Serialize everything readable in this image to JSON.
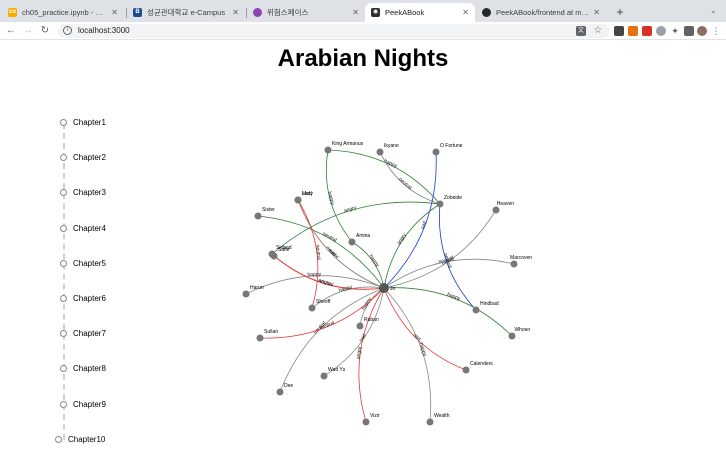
{
  "tabs": [
    {
      "label": "ch05_practice.ipynb - Colabor",
      "icon": "colab-icon",
      "color": "#f9ab00",
      "active": false
    },
    {
      "label": "성균관대학교 e-Campus",
      "icon": "ecampus-icon",
      "color": "#1a4d8f",
      "active": false
    },
    {
      "label": "위험스페이스",
      "icon": "space-icon",
      "color": "#8e44ad",
      "active": false
    },
    {
      "label": "PeekABook",
      "icon": "peekabook-icon",
      "color": "#2d2d2d",
      "active": true
    },
    {
      "label": "PeekABook/frontend at main ·",
      "icon": "github-icon",
      "color": "#24292e",
      "active": false
    }
  ],
  "address": {
    "url": "localhost:3000"
  },
  "page": {
    "title": "Arabian Nights"
  },
  "chapters": [
    "Chapter1",
    "Chapter2",
    "Chapter3",
    "Chapter4",
    "Chapter5",
    "Chapter6",
    "Chapter7",
    "Chapter8",
    "Chapter9",
    "Chapter10"
  ],
  "graph": {
    "center": "Jo",
    "nodes": [
      {
        "name": "King Armanus"
      },
      {
        "name": "Ikyane"
      },
      {
        "name": "O Fortune"
      },
      {
        "name": "Zobeide"
      },
      {
        "name": "Heaven"
      },
      {
        "name": "Marcoven"
      },
      {
        "name": "Hindbad"
      },
      {
        "name": "Whoso"
      },
      {
        "name": "Calenders"
      },
      {
        "name": "Wealth"
      },
      {
        "name": "Vizir"
      },
      {
        "name": "Lady"
      },
      {
        "name": "Ruban"
      },
      {
        "name": "Wad Ys"
      },
      {
        "name": "Dee"
      },
      {
        "name": "Sinbad"
      },
      {
        "name": "Harun"
      },
      {
        "name": "Sultan"
      },
      {
        "name": "Sister"
      },
      {
        "name": "Mad"
      },
      {
        "name": "Amina"
      },
      {
        "name": "Safie"
      },
      {
        "name": "Sheriff"
      }
    ],
    "edge_labels": [
      "happy",
      "neutral",
      "sad",
      "angry",
      "happy",
      "neutral",
      "neutral",
      "happy",
      "sad",
      "happy",
      "angry",
      "neutral",
      "happy",
      "sad",
      "neutral",
      "angry",
      "happy",
      "neutral",
      "neutral",
      "sad",
      "happy",
      "neutral",
      "happy",
      "angry",
      "neutral",
      "happy"
    ],
    "colors": {
      "green": "#2e7d32",
      "red": "#e53935",
      "gray": "#888888",
      "blue": "#1e3ad6",
      "node": "#777777"
    }
  }
}
